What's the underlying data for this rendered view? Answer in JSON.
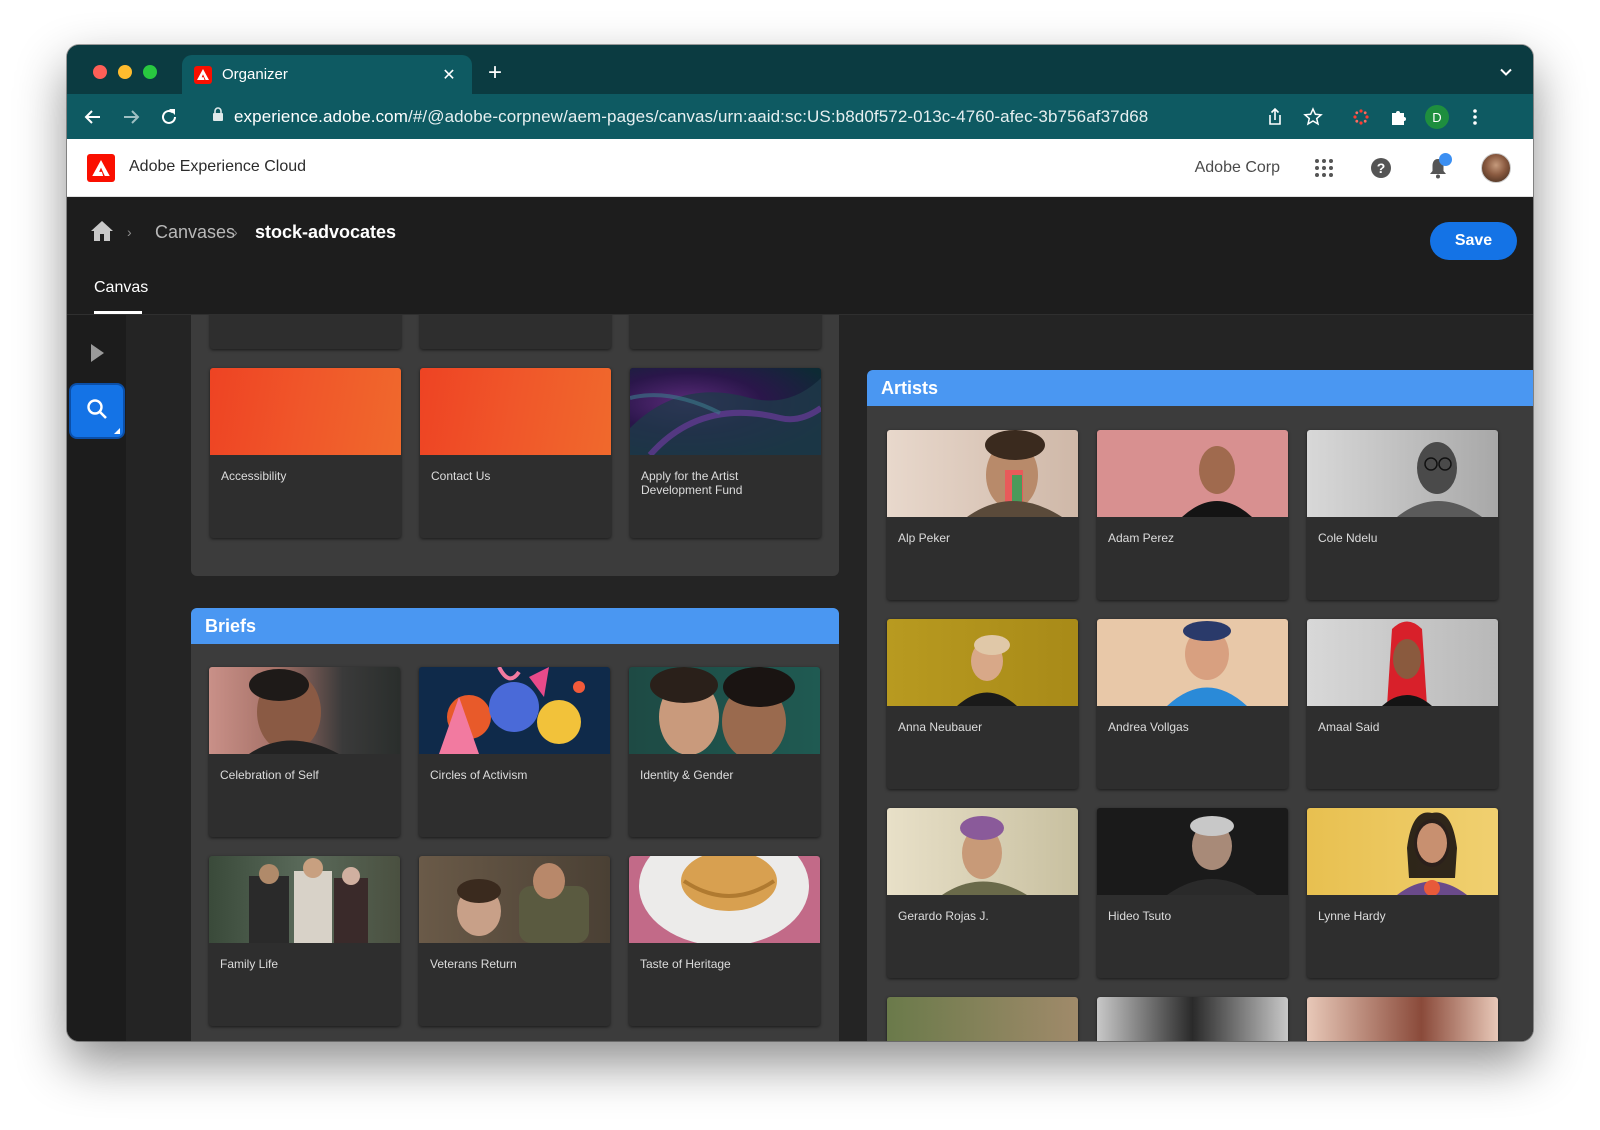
{
  "browser": {
    "tab_title": "Organizer",
    "url_host": "experience.adobe.com",
    "url_path": "/#/@adobe-corpnew/aem-pages/canvas/urn:aaid:sc:US:b8d0f572-013c-4760-afec-3b756af37d68",
    "profile_initial": "D"
  },
  "shell": {
    "title": "Adobe Experience Cloud",
    "org": "Adobe Corp"
  },
  "header": {
    "breadcrumb_parent": "Canvases",
    "breadcrumb_current": "stock-advocates",
    "save_label": "Save",
    "tab_label": "Canvas"
  },
  "top_panel": {
    "cards": [
      {
        "label": "Accessibility"
      },
      {
        "label": "Contact Us"
      },
      {
        "label": "Apply for the Artist Development Fund"
      }
    ]
  },
  "briefs": {
    "title": "Briefs",
    "cards": [
      {
        "label": "Celebration of Self"
      },
      {
        "label": "Circles of Activism"
      },
      {
        "label": "Identity & Gender"
      },
      {
        "label": "Family Life"
      },
      {
        "label": "Veterans Return"
      },
      {
        "label": "Taste of Heritage"
      }
    ]
  },
  "artists": {
    "title": "Artists",
    "cards": [
      {
        "label": "Alp Peker"
      },
      {
        "label": "Adam Perez"
      },
      {
        "label": "Cole Ndelu"
      },
      {
        "label": "Anna Neubauer"
      },
      {
        "label": "Andrea Vollgas"
      },
      {
        "label": "Amaal Said"
      },
      {
        "label": "Gerardo Rojas J."
      },
      {
        "label": "Hideo Tsuto"
      },
      {
        "label": "Lynne Hardy"
      }
    ]
  },
  "colors": {
    "brand_red": "#fa0f00",
    "accent_blue": "#1473e6",
    "panel_header_blue": "#4a97f2",
    "browser_teal": "#0e5a62"
  }
}
